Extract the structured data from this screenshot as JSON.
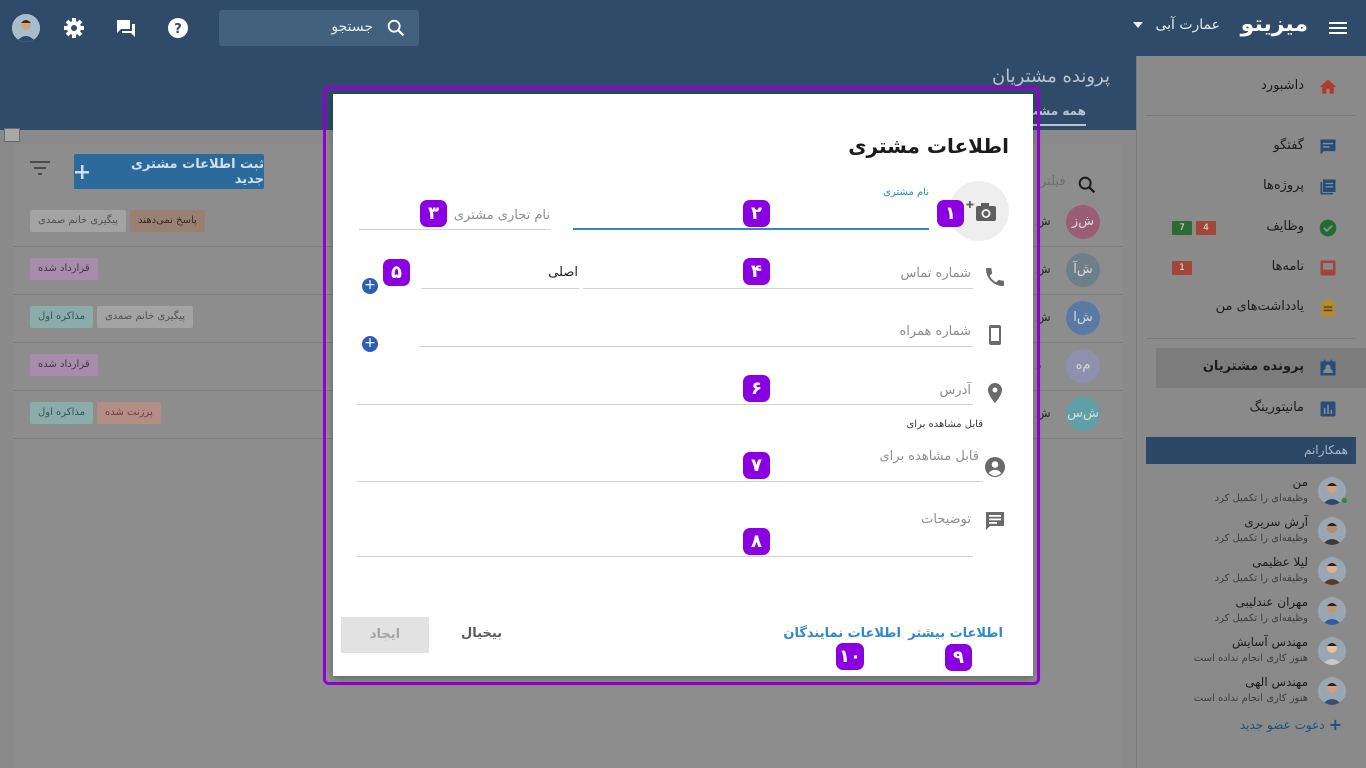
{
  "topbar": {
    "brand": "میزیتو",
    "company": "عمارت آبی",
    "search_placeholder": "جستجو"
  },
  "page": {
    "title": "پرونده مشتریان",
    "tab_all": "همه مشت",
    "new_button": "ثبت اطلاعات مشتری جدید",
    "filter_placeholder": "فیلتر"
  },
  "rows": [
    {
      "avatar": "ش‌ز",
      "avatar_color": "#9a5d73",
      "name": "ش",
      "tags": [
        {
          "text": "پاسخ نمی‌دهند",
          "bg": "#9a7f73",
          "fg": "#3a2a24"
        },
        {
          "text": "پیگیری خانم صمدی",
          "bg": "#a3a3a3",
          "fg": "#525252"
        }
      ]
    },
    {
      "avatar": "ش‌آ",
      "avatar_color": "#6f7f8a",
      "name": "ش",
      "tags": [
        {
          "text": "قرارداد شده",
          "bg": "#a68eab",
          "fg": "#4d2e55"
        }
      ]
    },
    {
      "avatar": "ش‌ا",
      "avatar_color": "#5a7aa6",
      "name": "ش",
      "tags": [
        {
          "text": "پیگیری خانم صمدی",
          "bg": "#a3a3a3",
          "fg": "#525252"
        },
        {
          "text": "مذاکره اول",
          "bg": "#8cabab",
          "fg": "#295c5c"
        }
      ]
    },
    {
      "avatar": "م‌ه",
      "avatar_color": "#8f8fae",
      "name": "د",
      "tags": [
        {
          "text": "قرارداد شده",
          "bg": "#a68eab",
          "fg": "#4d2e55"
        }
      ]
    },
    {
      "avatar": "ش‌س",
      "avatar_color": "#5e9fa8",
      "name": "ش",
      "tags": [
        {
          "text": "پرزنت شده",
          "bg": "#b38e87",
          "fg": "#7a3c30"
        },
        {
          "text": "مذاکره اول",
          "bg": "#8cabab",
          "fg": "#295c5c"
        }
      ]
    }
  ],
  "sidebar": {
    "items": [
      {
        "label": "داشبورد",
        "icon": "home-icon"
      },
      {
        "label": "گفتگو",
        "icon": "chat-icon"
      },
      {
        "label": "پروژه‌ها",
        "icon": "projects-icon"
      },
      {
        "label": "وظایف",
        "icon": "tasks-icon",
        "badges": [
          "7",
          "4"
        ]
      },
      {
        "label": "نامه‌ها",
        "icon": "letters-icon",
        "badges": [
          "1"
        ]
      },
      {
        "label": "یادداشت‌های من",
        "icon": "notes-icon"
      },
      {
        "label": "پرونده مشتریان",
        "icon": "customers-icon"
      },
      {
        "label": "مانیتورینگ",
        "icon": "monitoring-icon"
      }
    ],
    "colleagues_header": "همکارانم",
    "colleagues": [
      {
        "name": "من",
        "status": "وظیفه‌ای را تکمیل کرد"
      },
      {
        "name": "آرش سریری",
        "status": "وظیفه‌ای را تکمیل کرد"
      },
      {
        "name": "لیلا عظیمی",
        "status": "وظیفه‌ای را تکمیل کرد"
      },
      {
        "name": "مهران عندلیبی",
        "status": "وظیفه‌ای را تکمیل کرد"
      },
      {
        "name": "مهندس آسایش",
        "status": "هنوز کاری انجام نداده است"
      },
      {
        "name": "مهندس الهی",
        "status": "هنوز کاری انجام نداده است"
      }
    ],
    "invite": "دعوت عضو جدید"
  },
  "modal": {
    "title": "اطلاعات مشتری",
    "customer_name_label": "نام مشتری",
    "business_name_placeholder": "نام تجاری مشتری",
    "phone_placeholder": "شماره تماس",
    "phone_type": "اصلی",
    "mobile_placeholder": "شماره همراه",
    "address_placeholder": "آدرس",
    "visible_for_label": "قابل مشاهده برای",
    "visible_for_placeholder": "قابل مشاهده برای",
    "description_placeholder": "توضیحات",
    "more_info": "اطلاعات بیشتر",
    "reps_info": "اطلاعات نمایندگان",
    "cancel": "بیخیال",
    "create": "ایجاد",
    "markers": [
      "۱",
      "۲",
      "۳",
      "۴",
      "۵",
      "۶",
      "۷",
      "۸",
      "۹",
      "۱۰"
    ]
  },
  "colors": {
    "topbar": "#304a6a",
    "accent": "#2d89c8",
    "marker": "#8a00e0",
    "frame": "#9400d3"
  }
}
